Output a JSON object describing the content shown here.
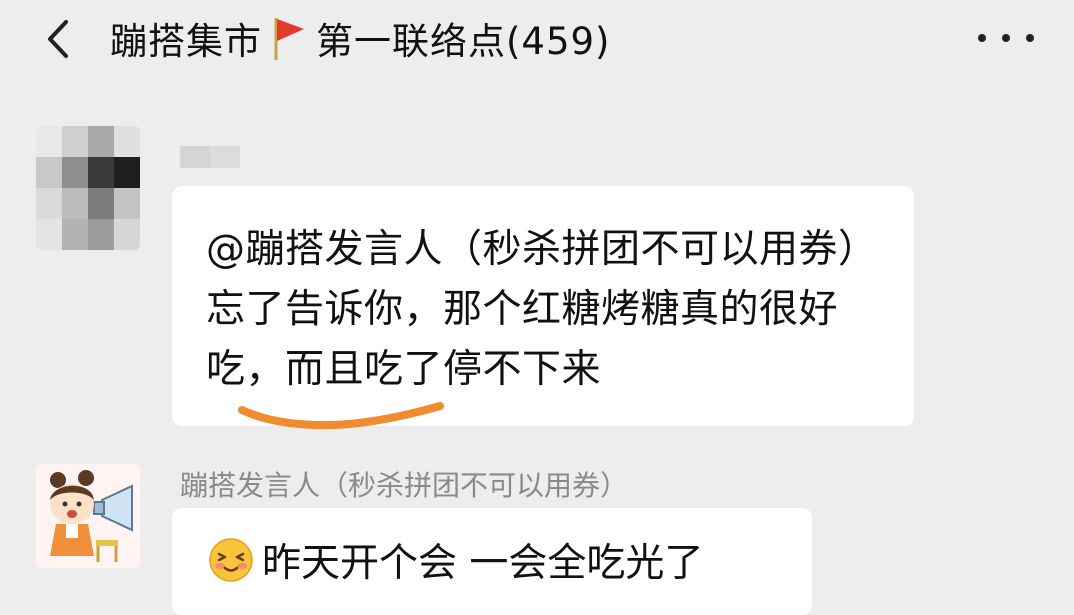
{
  "header": {
    "title": "蹦搭集市",
    "subtitle": "第一联络点(459)",
    "back_icon": "chevron-left-icon",
    "flag_icon": "red-flag-icon",
    "more_icon": "ellipsis-icon"
  },
  "messages": [
    {
      "sender_name": "",
      "avatar": "blurred-avatar",
      "text": "@蹦搭发言人（秒杀拼团不可以用券）忘了告诉你，那个红糖烤糖真的很好吃，而且吃了停不下来",
      "highlight_mark": "orange-underline"
    },
    {
      "sender_name": "蹦搭发言人（秒杀拼团不可以用券）",
      "avatar": "cartoon-girl-megaphone",
      "emoji": "blushing-face-emoji",
      "text": "昨天开个会 一会全吃光了"
    }
  ],
  "colors": {
    "background": "#ededed",
    "bubble": "#ffffff",
    "underline": "#f28a2e",
    "sender_name": "#8a8a8a",
    "flag": "#e23b2e"
  }
}
